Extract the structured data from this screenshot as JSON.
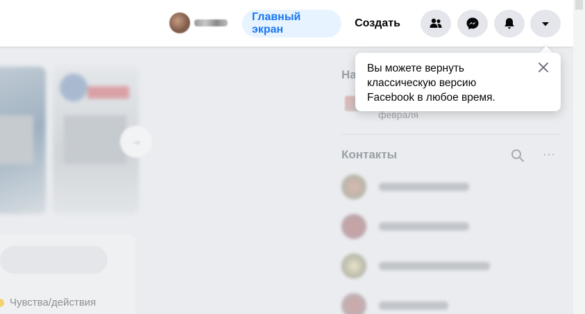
{
  "header": {
    "profile_name": "",
    "nav": {
      "home_label": "Главный экран",
      "create_label": "Создать"
    },
    "icons": [
      "friends-icon",
      "messenger-icon",
      "notifications-icon",
      "account-menu-icon"
    ],
    "accent_color": "#1877f2",
    "active_pill_bg": "#e7f3ff"
  },
  "feed": {
    "composer_action_label": "Чувства/действия"
  },
  "right_column": {
    "section_partial_heading": "На",
    "event_date_fragment": "февраля",
    "contacts_title": "Контакты",
    "contacts_more": "···",
    "contacts_count_visible": 4
  },
  "tooltip": {
    "lines": [
      "Вы можете вернуть",
      "классическую версию",
      "Facebook в любое время."
    ]
  }
}
